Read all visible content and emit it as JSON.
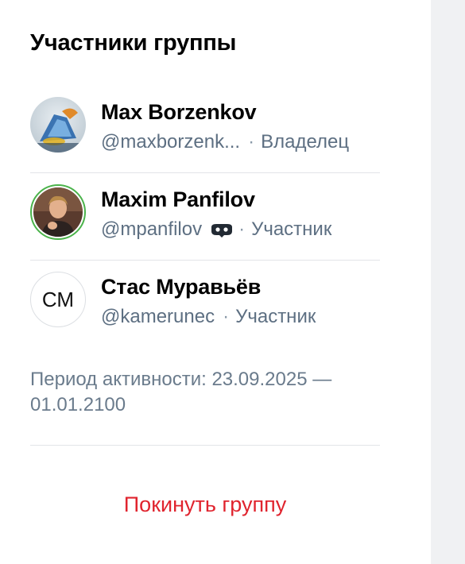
{
  "title": "Участники группы",
  "members": [
    {
      "name": "Max Borzenkov",
      "handle": "@maxborzenk...",
      "role": "Владелец",
      "avatar": "photo-glass-object"
    },
    {
      "name": "Maxim Panfilov",
      "handle": "@mpanfilov",
      "role": "Участник",
      "avatar": "photo-man",
      "badge_icon": "bot-mask-icon"
    },
    {
      "name": "Стас Муравьёв",
      "handle": "@kamerunec",
      "role": "Участник",
      "initials": "СМ"
    }
  ],
  "separator": "·",
  "activity_period": "Период активности: 23.09.2025 — 01.01.2100",
  "leave_label": "Покинуть группу",
  "colors": {
    "accent_red": "#e0242e",
    "meta_text": "#5d6f82",
    "online_ring": "#4bb34b",
    "gutter": "#f0f1f3"
  }
}
